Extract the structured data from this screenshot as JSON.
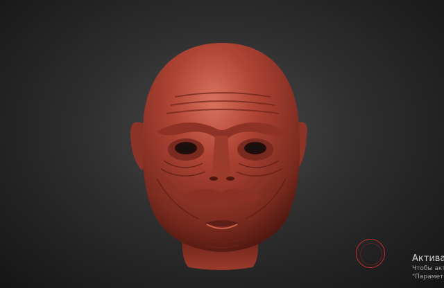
{
  "viewport": {
    "subject": "sculpt-head",
    "background_top": "#4a4a4a",
    "background_bottom": "#151515",
    "clay_color": "#b04535",
    "clay_shadow": "#5e1d15",
    "clay_highlight": "#d9735f"
  },
  "cursor": {
    "icon": "brush-cursor-icon",
    "color": "#c42b2b"
  },
  "activation_notice": {
    "title": "Активац",
    "line1": "Чтобы акт",
    "line2": "\"Парамет"
  }
}
